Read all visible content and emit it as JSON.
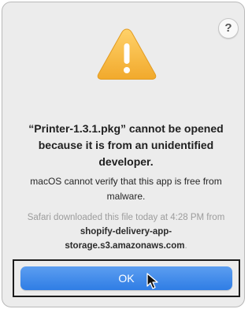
{
  "dialog": {
    "help_label": "?",
    "warning_icon": "warning-triangle-icon",
    "title": "“Printer-1.3.1.pkg” cannot be opened because it is from an unidentified developer.",
    "message": "macOS cannot verify that this app is free from malware.",
    "info_prefix": "Safari downloaded this file today at 4:28 PM from ",
    "info_source": "shopify-delivery-app-storage.s3.amazonaws.com",
    "info_suffix": ".",
    "ok_label": "OK"
  },
  "colors": {
    "accent": "#2f7de5",
    "warning": "#f4b43a",
    "background": "#ececec"
  }
}
